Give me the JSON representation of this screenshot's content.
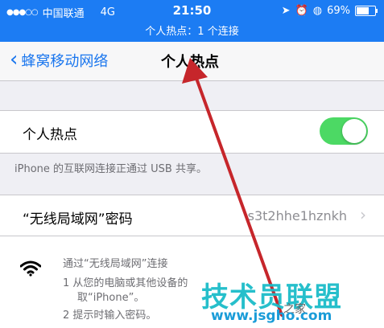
{
  "status_bar": {
    "signal_dots": "●●●○○",
    "carrier": "中国联通",
    "network": "4G",
    "time": "21:50",
    "battery_percent": "69%",
    "battery_level": 0.69
  },
  "hotspot_banner": "个人热点：1 个连接",
  "nav": {
    "back_label": "蜂窝移动网络",
    "title": "个人热点"
  },
  "hotspot_toggle": {
    "label": "个人热点",
    "on": true,
    "color": "#4cd964"
  },
  "usb_note": "iPhone 的互联网连接正通过 USB 共享。",
  "password_row": {
    "label": "“无线局域网”密码",
    "value": "s3t2hhe1hznkh"
  },
  "wifi_info": {
    "heading": "通过“无线局域网”连接",
    "step1_line1": "1 从您的电脑或其他设备的",
    "step1_line2": "取“iPhone”。",
    "step2": "2 提示时输入密码。"
  },
  "watermark": {
    "brand": "技术员联盟",
    "url": "www.jsgho.com",
    "sub": "之家"
  },
  "colors": {
    "accent": "#1c7cf3",
    "link": "#1a76ee",
    "arrow": "#c6262b"
  }
}
